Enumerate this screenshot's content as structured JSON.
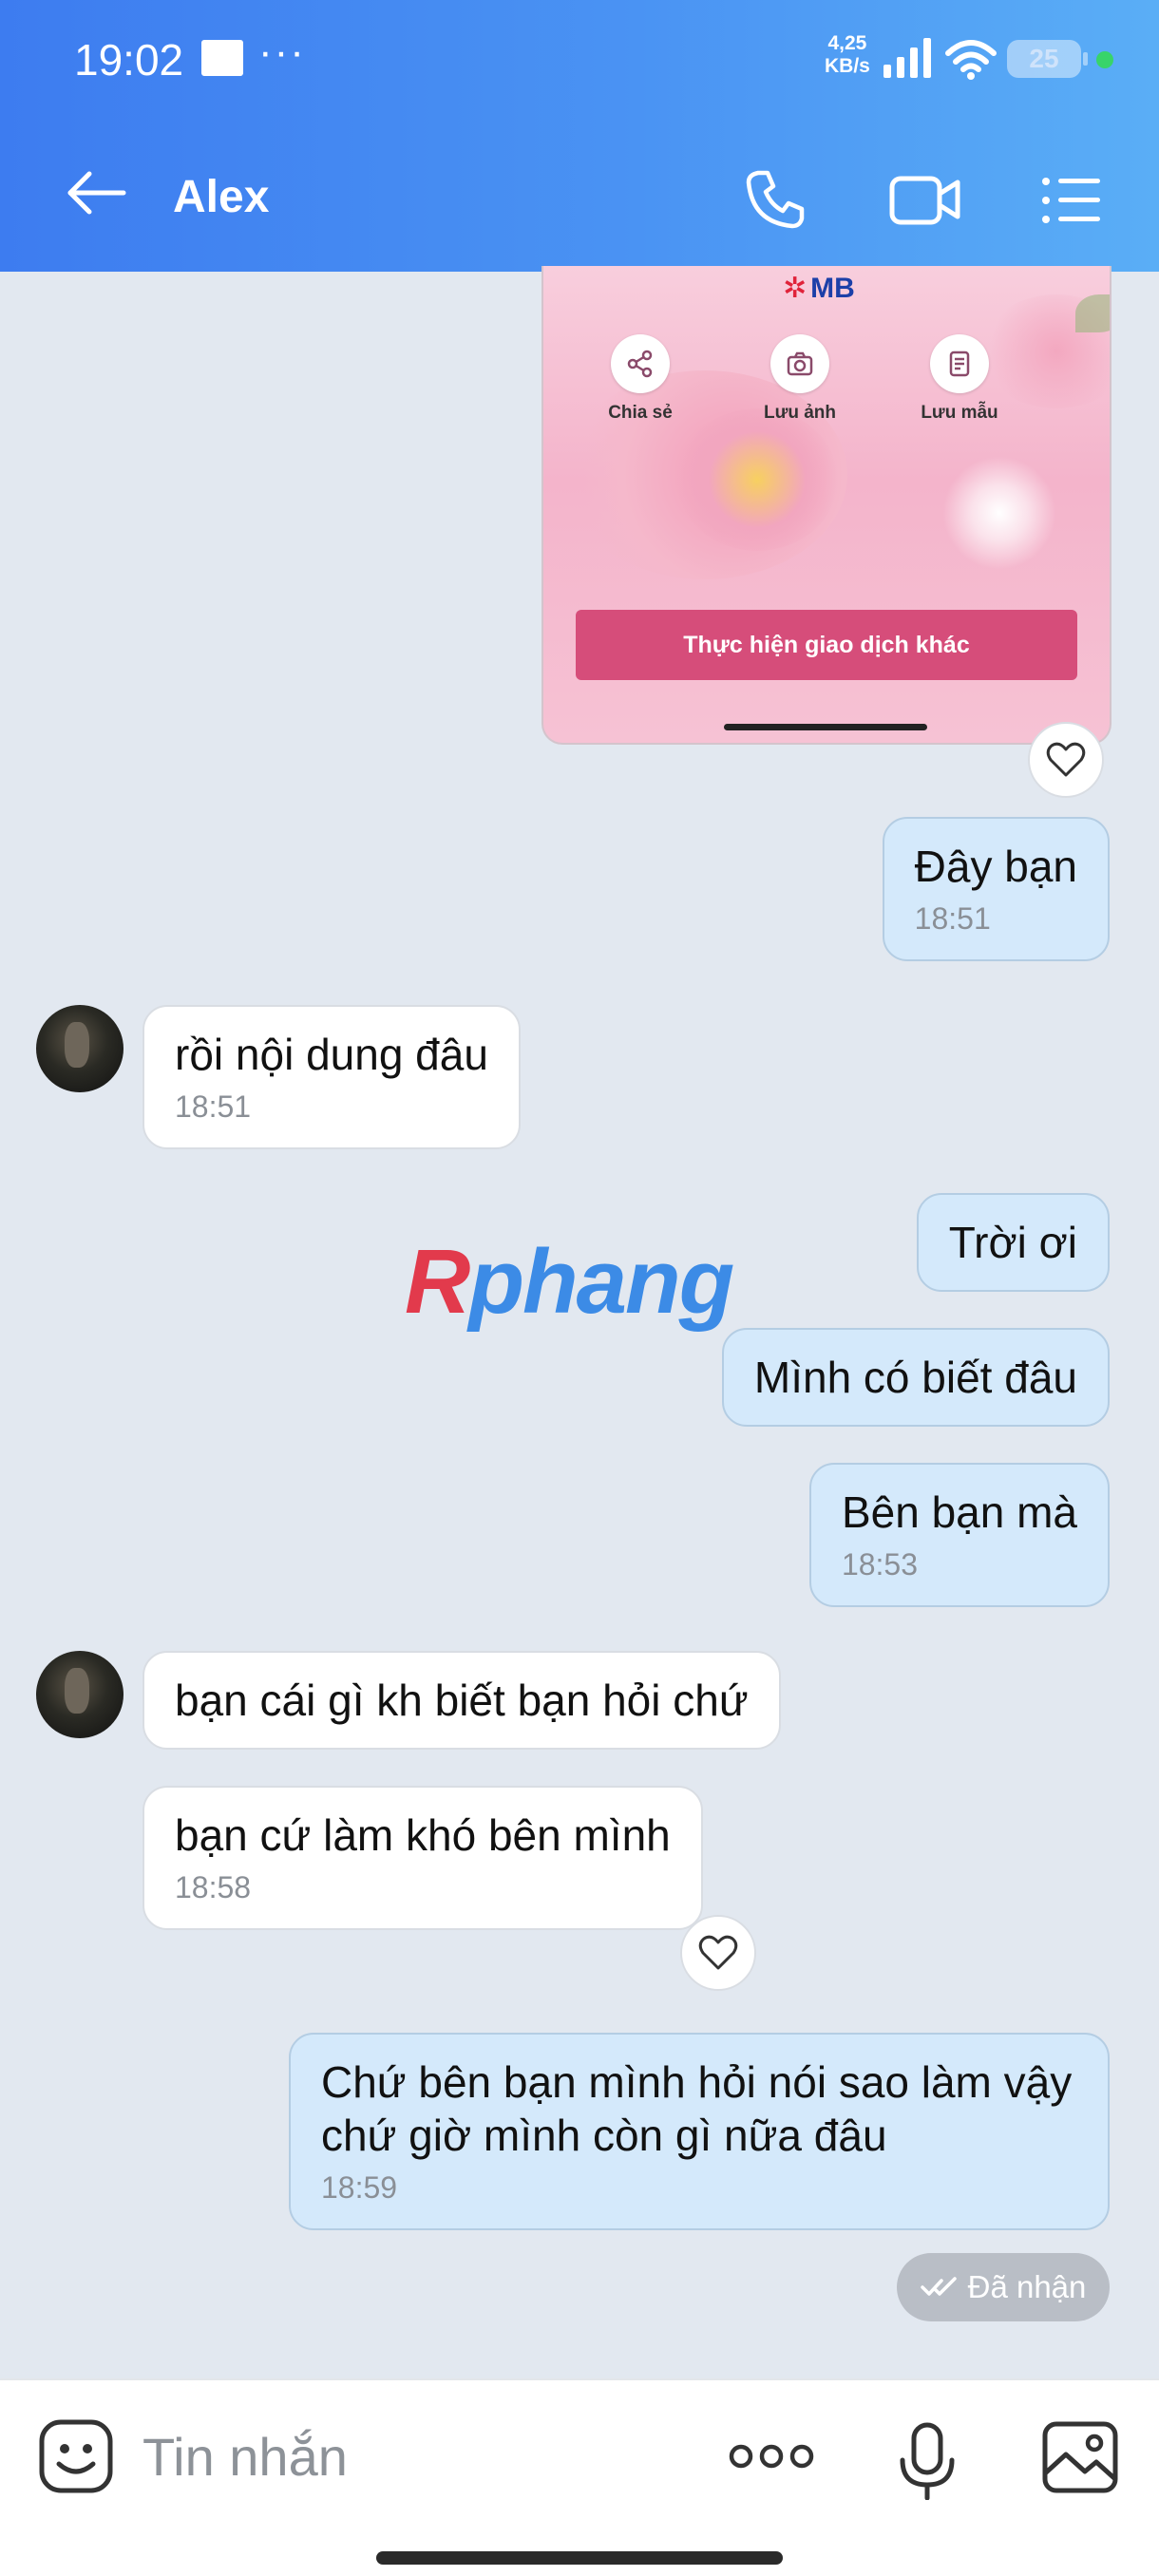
{
  "status_bar": {
    "time": "19:02",
    "dots": "···",
    "net_speed_value": "4,25",
    "net_speed_unit": "KB/s",
    "battery": "25"
  },
  "header": {
    "title": "Alex",
    "icons": [
      "back-arrow-icon",
      "phone-icon",
      "video-camera-icon",
      "menu-list-icon"
    ]
  },
  "shared_image": {
    "logo": "MB",
    "actions": [
      {
        "label": "Chia sẻ",
        "icon": "share-icon"
      },
      {
        "label": "Lưu ảnh",
        "icon": "camera-icon"
      },
      {
        "label": "Lưu mẫu",
        "icon": "document-icon"
      }
    ],
    "button": "Thực hiện giao dịch khác"
  },
  "messages": [
    {
      "side": "sent",
      "text": "Đây bạn",
      "time": "18:51"
    },
    {
      "side": "received",
      "text": "rồi nội dung đâu",
      "time": "18:51"
    },
    {
      "side": "sent",
      "text": "Trời ơi",
      "time": ""
    },
    {
      "side": "sent",
      "text": "Mình có biết đâu",
      "time": ""
    },
    {
      "side": "sent",
      "text": "Bên bạn mà",
      "time": "18:53"
    },
    {
      "side": "received",
      "text": "bạn cái gì kh biết bạn hỏi chứ",
      "time": ""
    },
    {
      "side": "received",
      "text": "bạn cứ làm khó bên mình",
      "time": "18:58"
    },
    {
      "side": "sent",
      "text": "Chứ bên bạn mình hỏi nói sao làm vậy chứ giờ mình còn gì nữa đâu",
      "time": "18:59"
    }
  ],
  "delivery_status": "Đã nhận",
  "watermark": {
    "first": "R",
    "rest": "phang"
  },
  "input_bar": {
    "placeholder": "Tin nhắn",
    "icons": [
      "sticker-icon",
      "more-options-icon",
      "microphone-icon",
      "gallery-icon"
    ]
  }
}
